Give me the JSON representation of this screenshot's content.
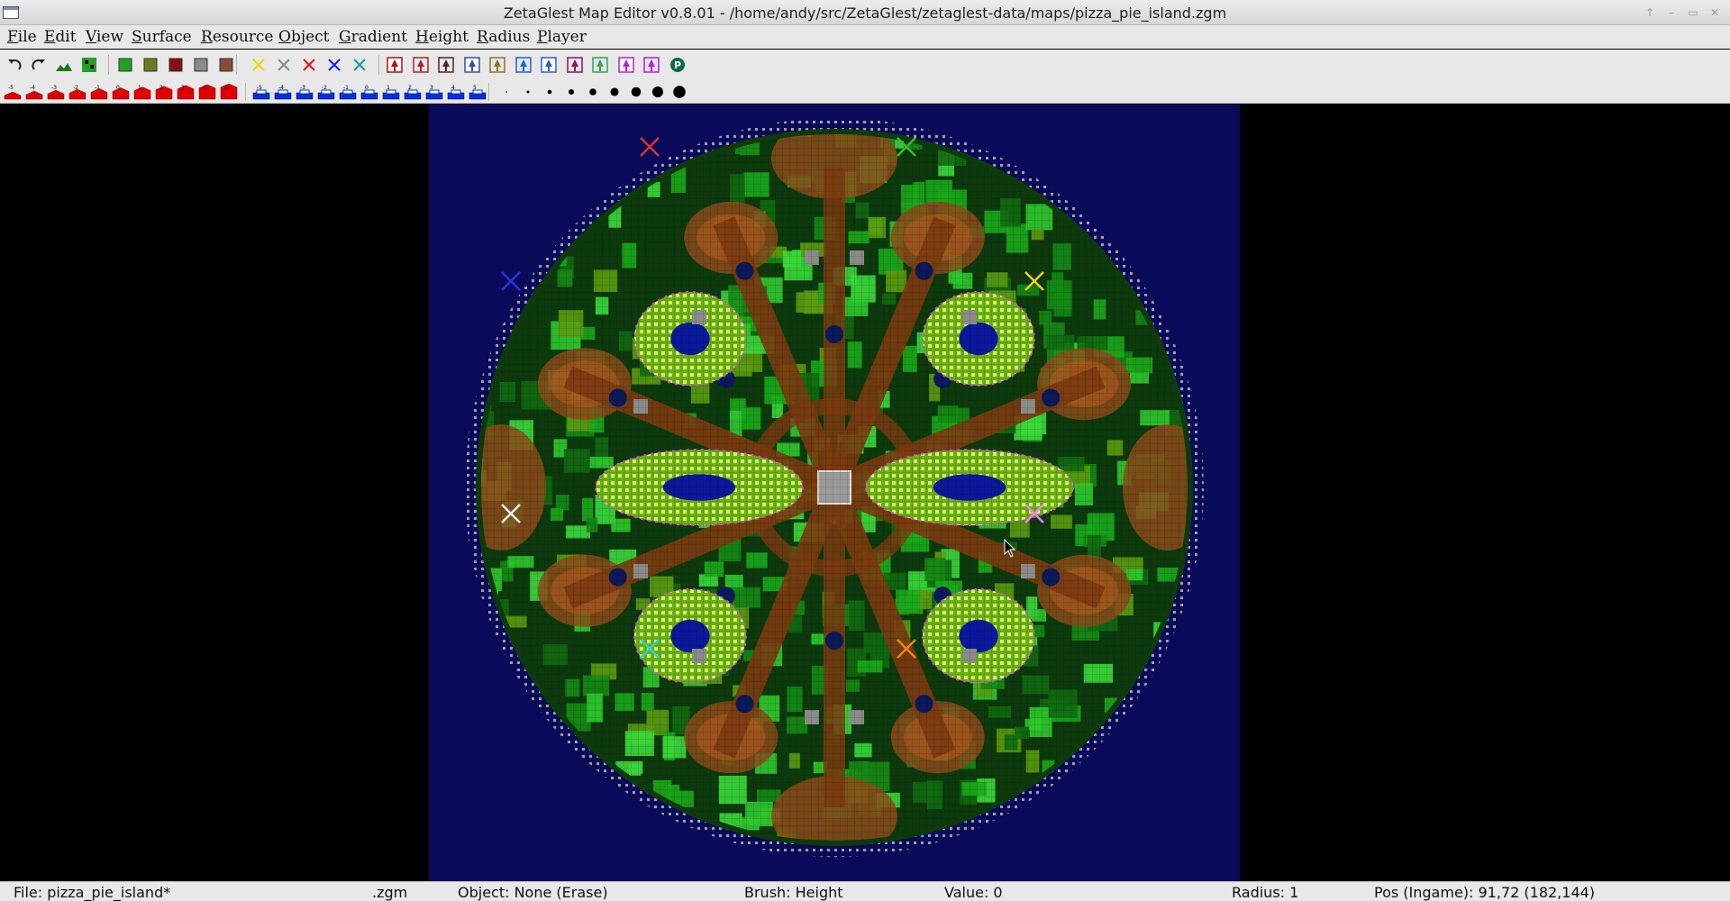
{
  "window": {
    "title": "ZetaGlest Map Editor v0.8.01 - /home/andy/src/ZetaGlest/zetaglest-data/maps/pizza_pie_island.zgm",
    "controls": [
      "↑",
      "–",
      "▭",
      "✕"
    ]
  },
  "menu": [
    "File",
    "Edit",
    "View",
    "Surface",
    "Resource",
    "Object",
    "Gradient",
    "Height",
    "Radius",
    "Player"
  ],
  "toolbar": {
    "surface_colors": [
      "#22a022",
      "#6a7c1a",
      "#8a1010",
      "#8a8a8a",
      "#8a4a3a"
    ],
    "player_cross_colors": [
      "#e8d800",
      "#8a8a8a",
      "#e81010",
      "#1020e8",
      "#10a0a0"
    ],
    "resource_icons": [
      "tree-icon",
      "rock-icon",
      "dead-tree-icon",
      "stone-icon",
      "bush-icon",
      "water-object-icon",
      "cactus-icon",
      "dead-tree-object-icon",
      "bones-icon",
      "statue-icon",
      "box-icon",
      "info-icon"
    ]
  },
  "height_tool_labels": [
    "-5",
    "-4",
    "-3",
    "-2",
    "-1",
    "0",
    "1",
    "2",
    "3",
    "4",
    "5"
  ],
  "gradient_tool_labels": [
    "-5",
    "-4",
    "-3",
    "-2",
    "-1",
    "0",
    "1",
    "2",
    "3",
    "4",
    "5"
  ],
  "radius_levels": [
    1,
    2,
    3,
    4,
    5,
    6,
    7,
    8,
    9
  ],
  "map": {
    "player_start_colors": [
      "#e03030",
      "#30c030",
      "#3030e0",
      "#f0d020",
      "#f0f0f0",
      "#f080f0",
      "#30d0d0",
      "#f08020"
    ],
    "water_color": "#0a0a5a",
    "grass_color": "#1aa81a",
    "road_color": "#7a3a10"
  },
  "status": {
    "file": "File: pizza_pie_island*",
    "ext": ".zgm",
    "object": "Object: None (Erase)",
    "brush": "Brush: Height",
    "value": "Value: 0",
    "radius": "Radius: 1",
    "pos": "Pos (Ingame): 91,72 (182,144)"
  }
}
